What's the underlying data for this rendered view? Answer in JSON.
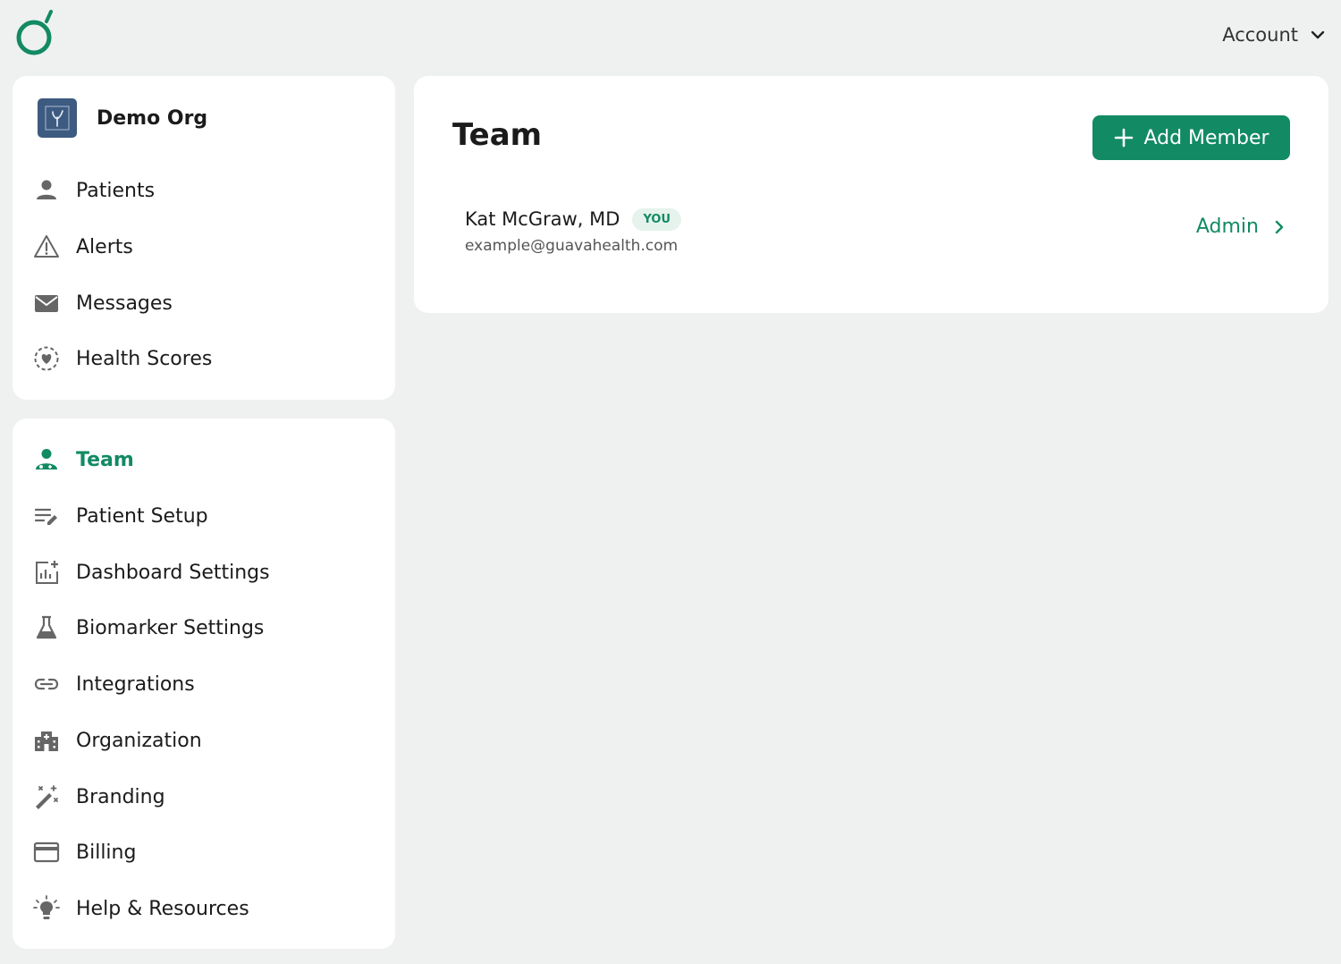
{
  "header": {
    "account_label": "Account"
  },
  "sidebar": {
    "org_name": "Demo Org",
    "primary_items": [
      {
        "label": "Patients",
        "icon": "person-icon"
      },
      {
        "label": "Alerts",
        "icon": "warning-icon"
      },
      {
        "label": "Messages",
        "icon": "mail-icon"
      },
      {
        "label": "Health Scores",
        "icon": "heart-circle-icon"
      }
    ],
    "settings_items": [
      {
        "label": "Team",
        "icon": "team-icon",
        "active": true
      },
      {
        "label": "Patient Setup",
        "icon": "list-edit-icon"
      },
      {
        "label": "Dashboard Settings",
        "icon": "chart-add-icon"
      },
      {
        "label": "Biomarker Settings",
        "icon": "flask-icon"
      },
      {
        "label": "Integrations",
        "icon": "link-icon"
      },
      {
        "label": "Organization",
        "icon": "building-icon"
      },
      {
        "label": "Branding",
        "icon": "magic-wand-icon"
      },
      {
        "label": "Billing",
        "icon": "credit-card-icon"
      },
      {
        "label": "Help & Resources",
        "icon": "lightbulb-icon"
      }
    ]
  },
  "main": {
    "title": "Team",
    "add_button_label": "Add Member",
    "members": [
      {
        "name": "Kat McGraw, MD",
        "badge": "YOU",
        "email": "example@guavahealth.com",
        "role": "Admin"
      }
    ]
  },
  "colors": {
    "accent": "#128a64",
    "background": "#eef1f0",
    "org_logo": "#3d5a80"
  }
}
